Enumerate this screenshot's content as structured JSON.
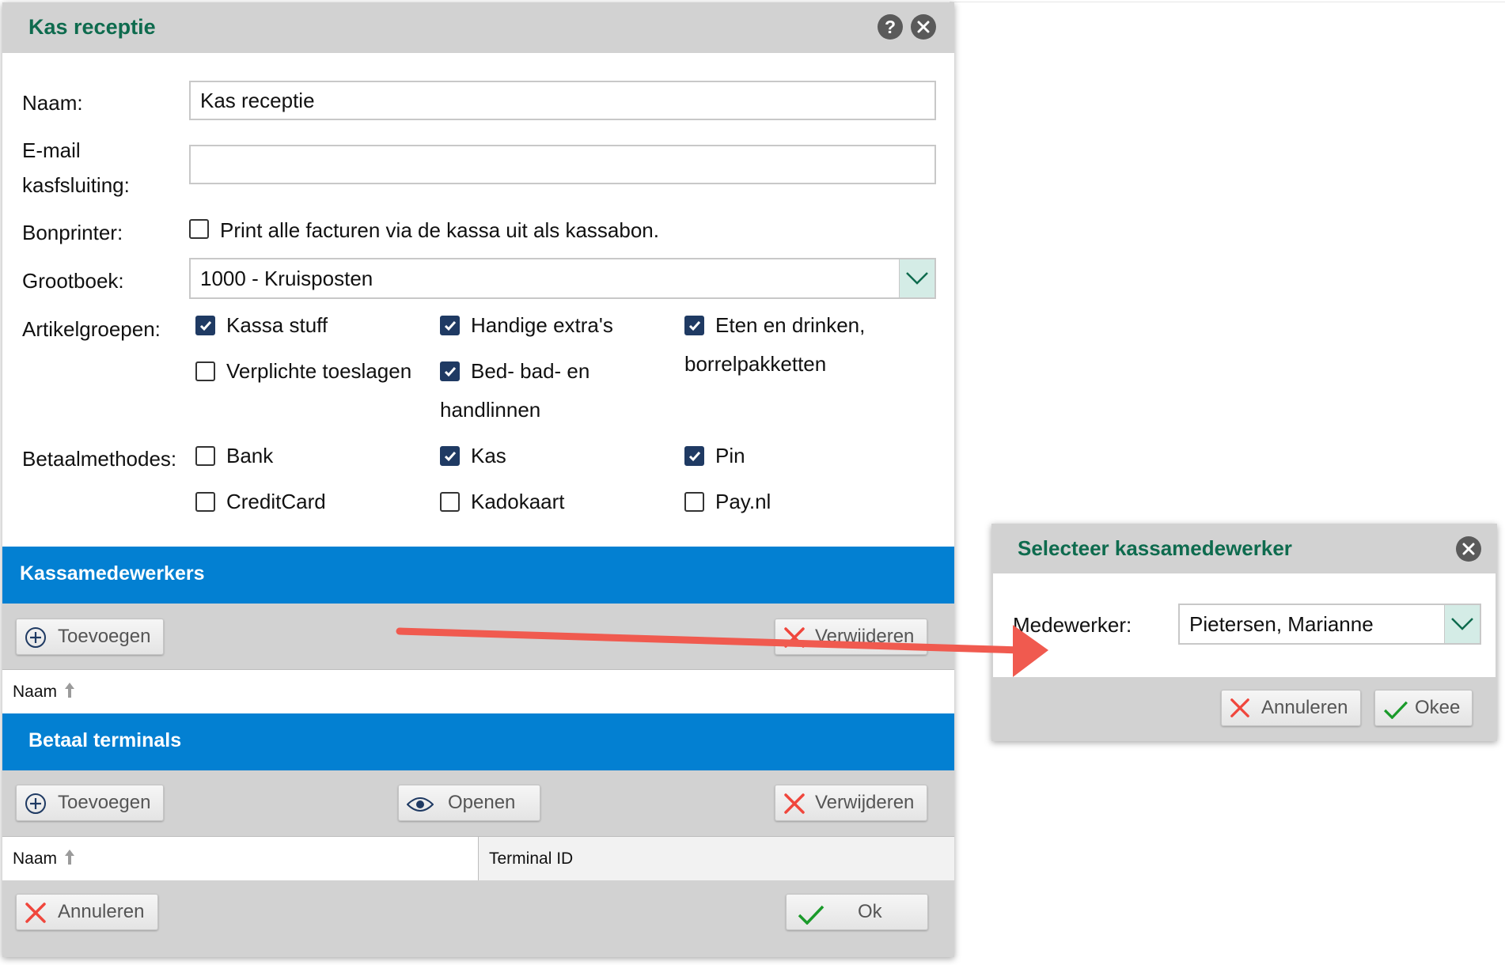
{
  "dialog": {
    "title": "Kas receptie",
    "help_icon": "question-icon",
    "close_icon": "close-icon",
    "fields": {
      "naam_label": "Naam:",
      "naam_value": "Kas receptie",
      "email_label_line1": "E-mail",
      "email_label_line2": "kasfsluiting:",
      "email_value": "",
      "bonprinter_label": "Bonprinter:",
      "bonprinter_option": "Print alle facturen via de kassa uit als kassabon.",
      "bonprinter_checked": false,
      "grootboek_label": "Grootboek:",
      "grootboek_value": "1000 - Kruisposten",
      "artikelgroepen_label": "Artikelgroepen:",
      "artikelgroepen": [
        {
          "label": "Kassa stuff",
          "checked": true
        },
        {
          "label": "Handige extra's",
          "checked": true
        },
        {
          "label": "Eten en drinken,",
          "label2": "borrelpakketten",
          "checked": true
        },
        {
          "label": "Verplichte toeslagen",
          "checked": false
        },
        {
          "label": "Bed- bad- en",
          "label2": "handlinnen",
          "checked": true
        }
      ],
      "betaalmethodes_label": "Betaalmethodes:",
      "betaalmethodes": [
        {
          "label": "Bank",
          "checked": false
        },
        {
          "label": "Kas",
          "checked": true
        },
        {
          "label": "Pin",
          "checked": true
        },
        {
          "label": "CreditCard",
          "checked": false
        },
        {
          "label": "Kadokaart",
          "checked": false
        },
        {
          "label": "Pay.nl",
          "checked": false
        }
      ]
    },
    "kassamedewerkers": {
      "title": "Kassamedewerkers",
      "add_label": "Toevoegen",
      "remove_label": "Verwijderen",
      "col_naam": "Naam"
    },
    "terminals": {
      "title": "Betaal terminals",
      "add_label": "Toevoegen",
      "open_label": "Openen",
      "remove_label": "Verwijderen",
      "col_naam": "Naam",
      "col_terminal": "Terminal ID"
    },
    "footer": {
      "cancel_label": "Annuleren",
      "ok_label": "Ok"
    }
  },
  "select_dialog": {
    "title": "Selecteer kassamedewerker",
    "medewerker_label": "Medewerker:",
    "medewerker_value": "Pietersen, Marianne",
    "cancel_label": "Annuleren",
    "ok_label": "Okee"
  },
  "colors": {
    "title_green": "#0e6b4e",
    "section_blue": "#0380d2",
    "checkbox_navy": "#1f3a63",
    "arrow_red": "#f05a4f"
  }
}
